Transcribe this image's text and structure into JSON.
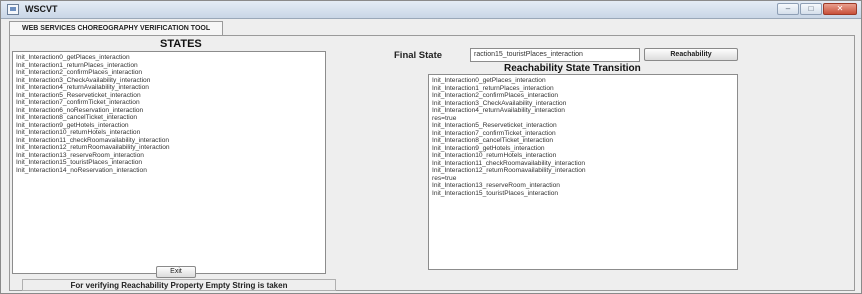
{
  "window": {
    "title": "WSCVT",
    "controls": [
      "–",
      "□",
      "✕"
    ]
  },
  "tab": {
    "label": "WEB SERVICES CHOREOGRAPHY VERIFICATION TOOL"
  },
  "states": {
    "title": "STATES",
    "items": [
      "Init_Interaction0_getPlaces_interaction",
      "Init_Interaction1_returnPlaces_interaction",
      "Init_Interaction2_confirmPlaces_interaction",
      "Init_Interaction3_CheckAvailability_interaction",
      "Init_Interaction4_returnAvailability_interaction",
      "Init_Interaction5_Reserveticket_interaction",
      "Init_Interaction7_confirmTicket_interaction",
      "Init_Interaction6_noReservation_interaction",
      "Init_Interaction8_cancelTicket_interaction",
      "Init_Interaction9_getHotels_interaction",
      "Init_Interaction10_returnHotels_interaction",
      "Init_Interaction11_checkRoomavailability_interaction",
      "Init_Interaction12_returnRoomavailability_interaction",
      "Init_Interaction13_reserveRoom_interaction",
      "Init_Interaction15_touristPlaces_interaction",
      "Init_Interaction14_noReservation_interaction"
    ]
  },
  "exit_button": {
    "label": "Exit"
  },
  "footer": {
    "note": "For verifying Reachability Property Empty String is taken"
  },
  "final_state": {
    "label": "Final State",
    "value": "raction15_touristPlaces_interaction"
  },
  "reachability_button": {
    "label": "Reachability"
  },
  "transition": {
    "title": "Reachability State Transition",
    "lines": [
      "Init_Interaction0_getPlaces_interaction",
      "Init_Interaction1_returnPlaces_interaction",
      "Init_Interaction2_confirmPlaces_interaction",
      "Init_Interaction3_CheckAvailability_interaction",
      "Init_Interaction4_returnAvailability_interaction",
      "res=true",
      "Init_Interaction5_Reserveticket_interaction",
      "Init_Interaction7_confirmTicket_interaction",
      "Init_Interaction8_cancelTicket_interaction",
      "Init_Interaction9_getHotels_interaction",
      "Init_Interaction10_returnHotels_interaction",
      "Init_Interaction11_checkRoomavailability_interaction",
      "Init_Interaction12_returnRoomavailability_interaction",
      "res=true",
      "Init_Interaction13_reserveRoom_interaction",
      "Init_Interaction15_touristPlaces_interaction"
    ]
  }
}
